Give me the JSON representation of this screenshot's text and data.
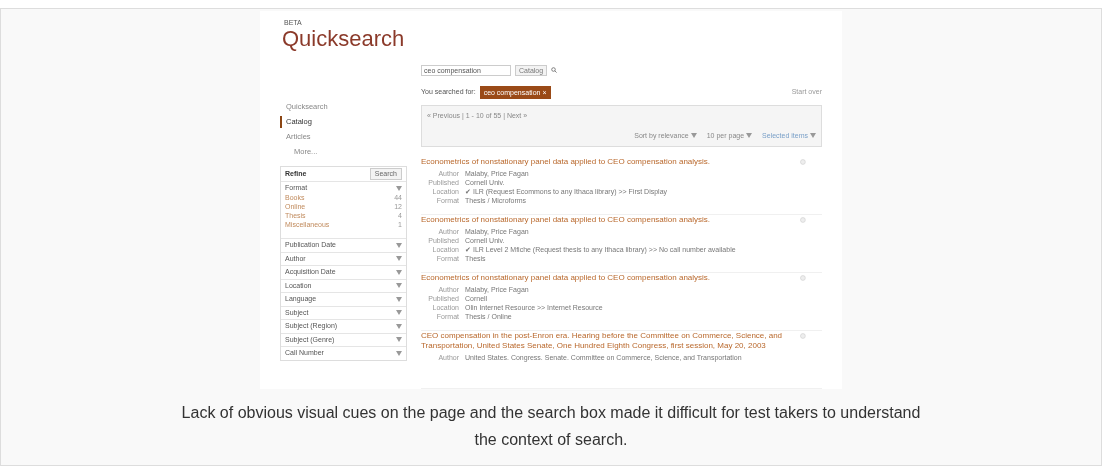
{
  "header": {
    "beta": "BETA",
    "logo": "Quicksearch"
  },
  "search": {
    "value": "ceo compensation",
    "scope": "Catalog"
  },
  "nav": [
    {
      "label": "Quicksearch",
      "selected": false
    },
    {
      "label": "Catalog",
      "selected": true
    },
    {
      "label": "Articles",
      "selected": false
    },
    {
      "label": "More...",
      "selected": false
    }
  ],
  "refine": {
    "title": "Refine",
    "button": "Search",
    "format_title": "Format",
    "format_items": [
      {
        "label": "Books",
        "count": "44"
      },
      {
        "label": "Online",
        "count": "12"
      },
      {
        "label": "Thesis",
        "count": "4"
      },
      {
        "label": "Miscellaneous",
        "count": "1"
      }
    ],
    "facets": [
      "Publication Date",
      "Author",
      "Acquisition Date",
      "Location",
      "Language",
      "Subject",
      "Subject (Region)",
      "Subject (Genre)",
      "Call Number"
    ]
  },
  "searched": {
    "label": "You searched for:",
    "tag": "ceo compensation",
    "remove": "×"
  },
  "start_over": "Start over",
  "pager": {
    "text": "« Previous | 1 - 10 of 55 | Next »",
    "sort": "Sort by relevance",
    "per_page": "10 per page",
    "actions": "Selected items"
  },
  "results": [
    {
      "title": "Econometrics of nonstationary panel data applied to CEO compensation analysis.",
      "fields": [
        {
          "label": "Author",
          "value": "Malaby, Price Fagan"
        },
        {
          "label": "Published",
          "value": "Cornell Univ."
        },
        {
          "label": "Location",
          "value": "✔ ILR (Request Ecommons to any Ithaca library) >> First Display"
        },
        {
          "label": "Format",
          "value": "Thesis / Microforms"
        }
      ]
    },
    {
      "title": "Econometrics of nonstationary panel data applied to CEO compensation analysis.",
      "fields": [
        {
          "label": "Author",
          "value": "Malaby, Price Fagan"
        },
        {
          "label": "Published",
          "value": "Cornell Univ."
        },
        {
          "label": "Location",
          "value": "✔ ILR Level 2 Mfiche (Request thesis to any Ithaca library) >> No call number available"
        },
        {
          "label": "Format",
          "value": "Thesis"
        }
      ]
    },
    {
      "title": "Econometrics of nonstationary panel data applied to CEO compensation analysis.",
      "fields": [
        {
          "label": "Author",
          "value": "Malaby, Price Fagan"
        },
        {
          "label": "Published",
          "value": "Cornell"
        },
        {
          "label": "Location",
          "value": "Olin Internet Resource >> Internet Resource"
        },
        {
          "label": "Format",
          "value": "Thesis / Online"
        }
      ]
    },
    {
      "title": "CEO compensation in the post-Enron era. Hearing before the Committee on Commerce, Science, and Transportation, United States Senate, One Hundred Eighth Congress, first session, May 20, 2003",
      "fields": [
        {
          "label": "Author",
          "value": "United States. Congress. Senate. Committee on Commerce, Science, and Transportation"
        }
      ]
    }
  ],
  "caption": "Lack of obvious visual cues on the page and the search box made it difficult for test takers to understand the context of search."
}
